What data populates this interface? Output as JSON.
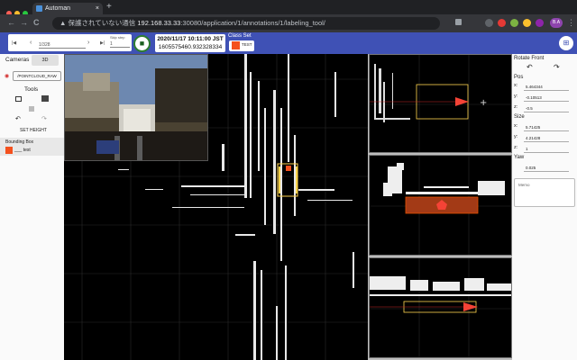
{
  "browser": {
    "tab_title": "Automan",
    "tab_close": "×",
    "new_tab": "+",
    "back": "←",
    "forward": "→",
    "reload": "C",
    "security_warning": "▲ 保護されていない通信",
    "url_host": "192.168.33.33",
    "url_rest": ":30080/application/1/annotations/1/labeling_tool/",
    "user_badge": "B.A",
    "colors": {
      "close": "#ff5f57",
      "minimize": "#febc2e",
      "zoom": "#28c840"
    }
  },
  "toolbar": {
    "first_frame": "|◀",
    "prev_frame": "‹",
    "frame_value": "1/328",
    "next_frame": "›",
    "last_frame": "▶|",
    "skip_label": "Skip step",
    "skip_value": "1",
    "lock_icon": "🔒",
    "datetime": "2020/11/17 10:11:00 JST",
    "timestamp": "1605575460.932328334",
    "class_set_label": "Class Set",
    "class_name": "TEST",
    "class_color": "#f4511e",
    "menu_icon": "⊞",
    "accent": "#3f51b5"
  },
  "left_panel": {
    "cameras_label": "Cameras",
    "btn_3d": "3D",
    "pointcloud_label": "/POINTCLOUD_RAW",
    "tools_label": "Tools",
    "set_height_label": "SET HEIGHT",
    "bbox_header": "Bounding Box",
    "bbox_item_label": "___ test",
    "bbox_color": "#f4511e"
  },
  "right_panel": {
    "rotate_label": "Rotate Front",
    "rotate_ccw": "↶",
    "rotate_cw": "↷",
    "pos_label": "Pos",
    "pos": {
      "x": "5.464344",
      "y": "-0.10513",
      "z": "-0.5"
    },
    "size_label": "Size",
    "size": {
      "x": "5.71425",
      "y": "4.21428",
      "z": "1"
    },
    "yaw_label": "Yaw",
    "yaw": "0.025",
    "memo_placeholder": "Memo",
    "axis_x": "x:",
    "axis_y": "y:",
    "axis_z": "z:"
  }
}
